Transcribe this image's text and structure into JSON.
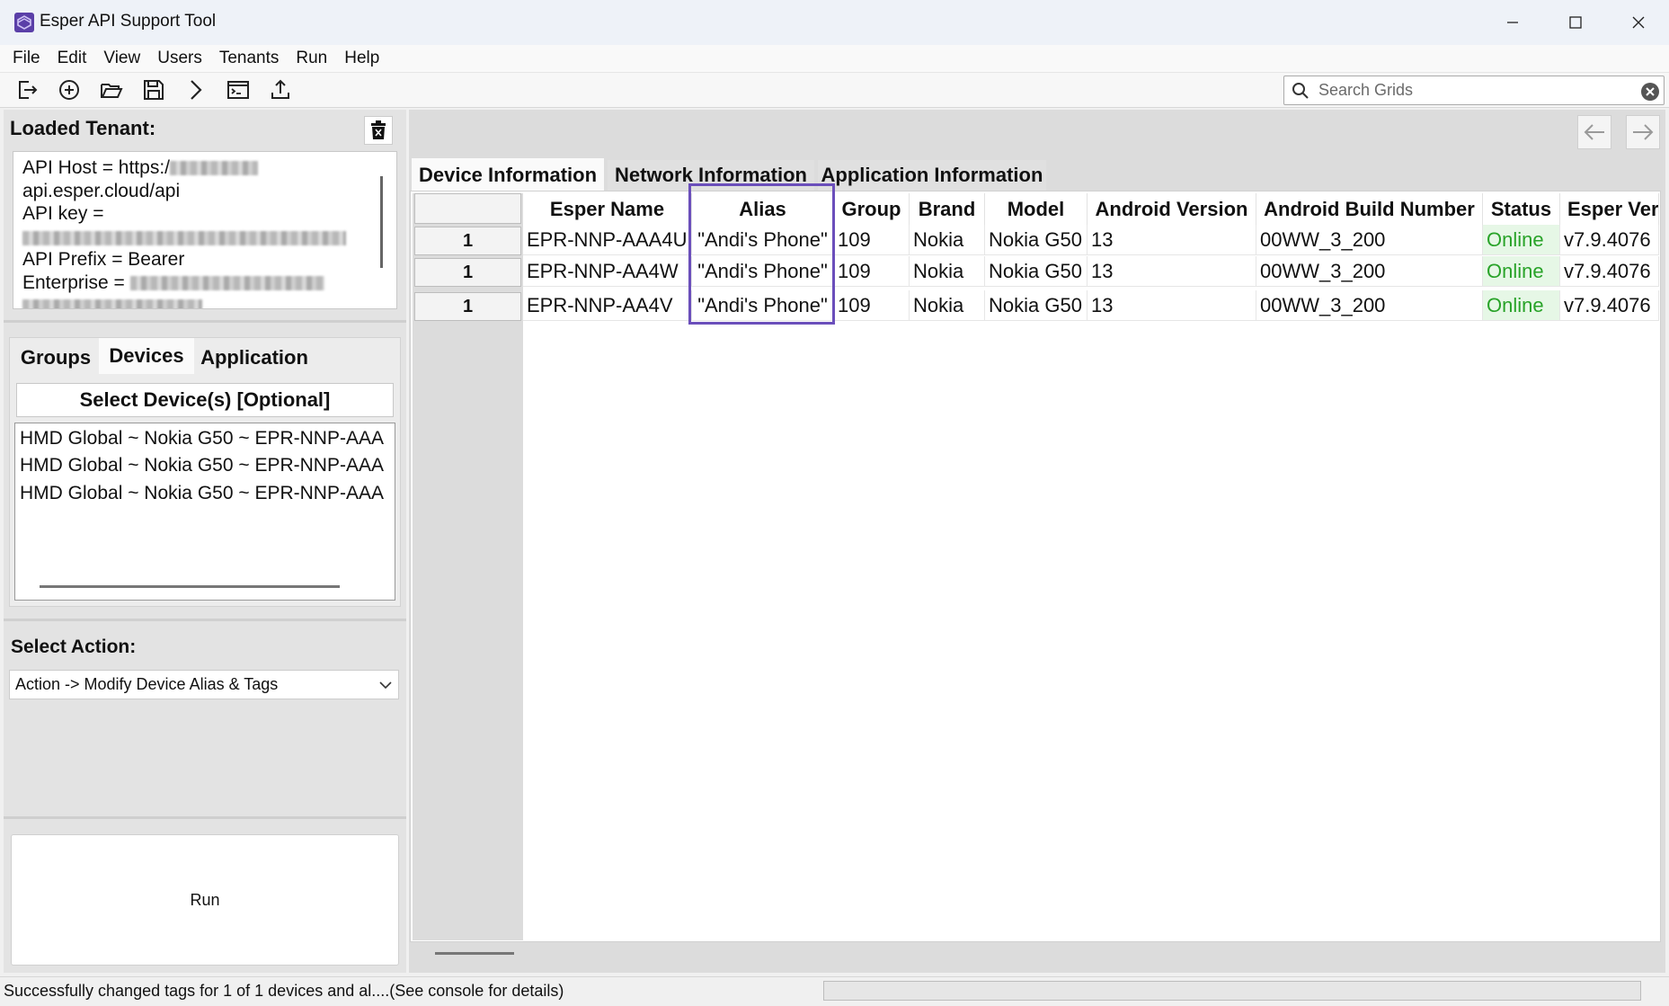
{
  "window": {
    "title": "Esper API Support Tool",
    "accent": "#6b4fbb"
  },
  "menu": [
    "File",
    "Edit",
    "View",
    "Users",
    "Tenants",
    "Run",
    "Help"
  ],
  "toolbar": {
    "icons": [
      "logout-icon",
      "add-circle-icon",
      "open-folder-icon",
      "save-icon",
      "run-chevron-icon",
      "console-icon",
      "upload-icon"
    ],
    "search_placeholder": "Search Grids"
  },
  "tenant": {
    "label": "Loaded Tenant:",
    "lines": [
      "API Host = https:/",
      "api.esper.cloud/api",
      "API key =",
      "",
      "API Prefix = Bearer",
      "Enterprise ="
    ]
  },
  "left_tabs": [
    "Groups",
    "Devices",
    "Application"
  ],
  "select_devices_label": "Select Device(s) [Optional]",
  "device_list": [
    "HMD Global ~ Nokia G50 ~ EPR-NNP-AAA",
    "HMD Global ~ Nokia G50 ~ EPR-NNP-AAA",
    "HMD Global ~ Nokia G50 ~ EPR-NNP-AAA"
  ],
  "action": {
    "label": "Select Action:",
    "selected": "Action -> Modify Device Alias & Tags"
  },
  "run_label": "Run",
  "right_tabs": [
    "Device Information",
    "Network Information",
    "Application Information"
  ],
  "grid": {
    "columns": [
      "Esper Name",
      "Alias",
      "Group",
      "Brand",
      "Model",
      "Android Version",
      "Android Build Number",
      "Status",
      "Esper Ver"
    ],
    "rows": [
      {
        "index": "1",
        "cells": [
          "EPR-NNP-AAA4U",
          "\"Andi's Phone\"",
          "109",
          "Nokia",
          "Nokia G50",
          "13",
          "00WW_3_200",
          "Online",
          "v7.9.4076"
        ]
      },
      {
        "index": "1",
        "cells": [
          "EPR-NNP-AA4W",
          "\"Andi's Phone\"",
          "109",
          "Nokia",
          "Nokia G50",
          "13",
          "00WW_3_200",
          "Online",
          "v7.9.4076"
        ]
      },
      {
        "index": "1",
        "cells": [
          "EPR-NNP-AA4V",
          "\"Andi's Phone\"",
          "109",
          "Nokia",
          "Nokia G50",
          "13",
          "00WW_3_200",
          "Online",
          "v7.9.4076"
        ]
      }
    ],
    "status_color": "#29a329"
  },
  "status_bar": {
    "text": "Successfully changed tags for 1 of 1 devices and al....(See console for details)"
  }
}
